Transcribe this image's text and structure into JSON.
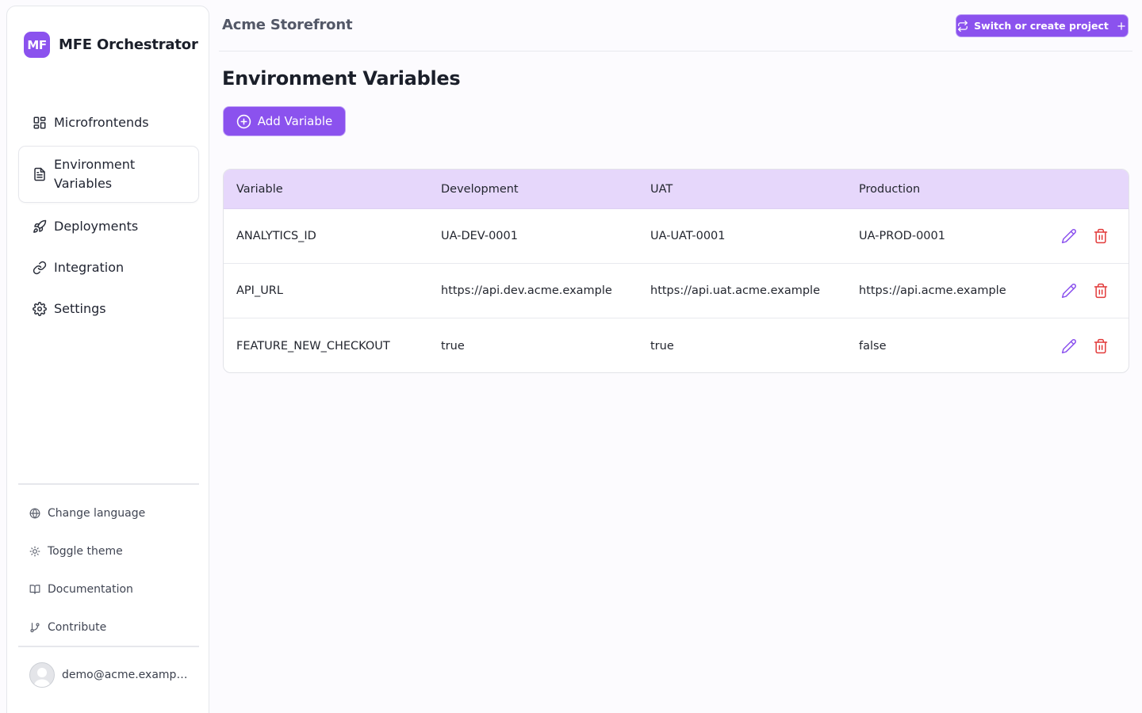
{
  "brand": {
    "logo_text": "MF",
    "name": "MFE Orchestrator",
    "accent_color": "#8b52ee"
  },
  "sidebar": {
    "items": [
      {
        "label": "Microfrontends",
        "icon": "grid-icon"
      },
      {
        "label": "Environment Variables",
        "icon": "file-text-icon",
        "active": true
      },
      {
        "label": "Deployments",
        "icon": "rocket-icon"
      },
      {
        "label": "Integration",
        "icon": "link-icon"
      },
      {
        "label": "Settings",
        "icon": "gear-icon"
      }
    ],
    "utilities": [
      {
        "label": "Change language",
        "icon": "globe-icon"
      },
      {
        "label": "Toggle theme",
        "icon": "sun-icon"
      },
      {
        "label": "Documentation",
        "icon": "book-open-icon"
      },
      {
        "label": "Contribute",
        "icon": "git-branch-icon"
      }
    ],
    "user": {
      "email": "demo@acme.example.com"
    }
  },
  "header": {
    "project_title": "Acme Storefront",
    "switch_label": "Switch or create project"
  },
  "main": {
    "title": "Environment Variables",
    "add_label": "Add Variable",
    "table": {
      "columns": [
        "Variable",
        "Development",
        "UAT",
        "Production"
      ],
      "rows": [
        [
          "ANALYTICS_ID",
          "UA-DEV-0001",
          "UA-UAT-0001",
          "UA-PROD-0001"
        ],
        [
          "API_URL",
          "https://api.dev.acme.example",
          "https://api.uat.acme.example",
          "https://api.acme.example"
        ],
        [
          "FEATURE_NEW_CHECKOUT",
          "true",
          "true",
          "false"
        ]
      ],
      "header_bg": "#e6d7fb",
      "edit_color": "#8b52ee",
      "delete_color": "#e23b3b"
    }
  }
}
